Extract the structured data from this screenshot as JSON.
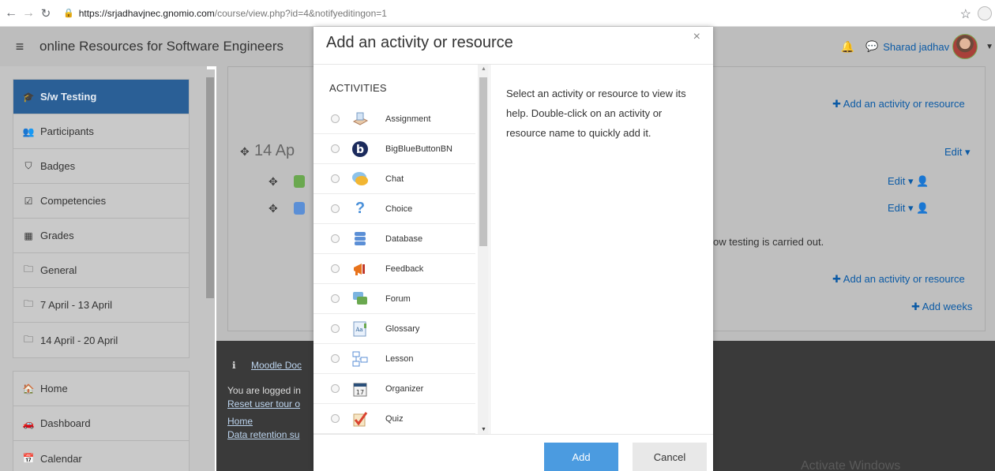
{
  "browser": {
    "url_host": "https://srjadhavjnec.gnomio.com",
    "url_path": "/course/view.php?id=4&notifyeditingon=1"
  },
  "navbar": {
    "site_name": "online Resources for Software Engineers",
    "user_name": "Sharad jadhav"
  },
  "drawer": {
    "course_items": [
      {
        "label": "S/w Testing",
        "icon": "graduation-cap-icon"
      },
      {
        "label": "Participants",
        "icon": "users-icon"
      },
      {
        "label": "Badges",
        "icon": "shield-icon"
      },
      {
        "label": "Competencies",
        "icon": "checkbox-icon"
      },
      {
        "label": "Grades",
        "icon": "table-icon"
      },
      {
        "label": "General",
        "icon": "folder-icon"
      },
      {
        "label": "7 April - 13 April",
        "icon": "folder-icon"
      },
      {
        "label": "14 April - 20 April",
        "icon": "folder-icon"
      }
    ],
    "site_items": [
      {
        "label": "Home",
        "icon": "home-icon"
      },
      {
        "label": "Dashboard",
        "icon": "dashboard-icon"
      },
      {
        "label": "Calendar",
        "icon": "calendar-icon"
      }
    ]
  },
  "main": {
    "add_activity_top": "Add an activity or resource",
    "section_title": "14 Ap",
    "edit_label": "Edit",
    "summary_text": "ow testing is carried out.",
    "add_activity_bottom": "Add an activity or resource",
    "add_weeks": "Add weeks"
  },
  "footer": {
    "moodle_docs": "Moodle Doc",
    "logged_in": "You are logged in",
    "reset_tour": "Reset user tour o",
    "home": "Home",
    "data_retention": "Data retention su",
    "watermark": "Activate Windows"
  },
  "modal": {
    "title": "Add an activity or resource",
    "section_label": "ACTIVITIES",
    "activities": [
      {
        "label": "Assignment",
        "icon": "assignment-icon"
      },
      {
        "label": "BigBlueButtonBN",
        "icon": "bigbluebutton-icon"
      },
      {
        "label": "Chat",
        "icon": "chat-icon"
      },
      {
        "label": "Choice",
        "icon": "choice-icon"
      },
      {
        "label": "Database",
        "icon": "database-icon"
      },
      {
        "label": "Feedback",
        "icon": "feedback-icon"
      },
      {
        "label": "Forum",
        "icon": "forum-icon"
      },
      {
        "label": "Glossary",
        "icon": "glossary-icon"
      },
      {
        "label": "Lesson",
        "icon": "lesson-icon"
      },
      {
        "label": "Organizer",
        "icon": "organizer-icon"
      },
      {
        "label": "Quiz",
        "icon": "quiz-icon"
      }
    ],
    "help_text": "Select an activity or resource to view its help. Double-click on an activity or resource name to quickly add it.",
    "add_button": "Add",
    "cancel_button": "Cancel"
  }
}
